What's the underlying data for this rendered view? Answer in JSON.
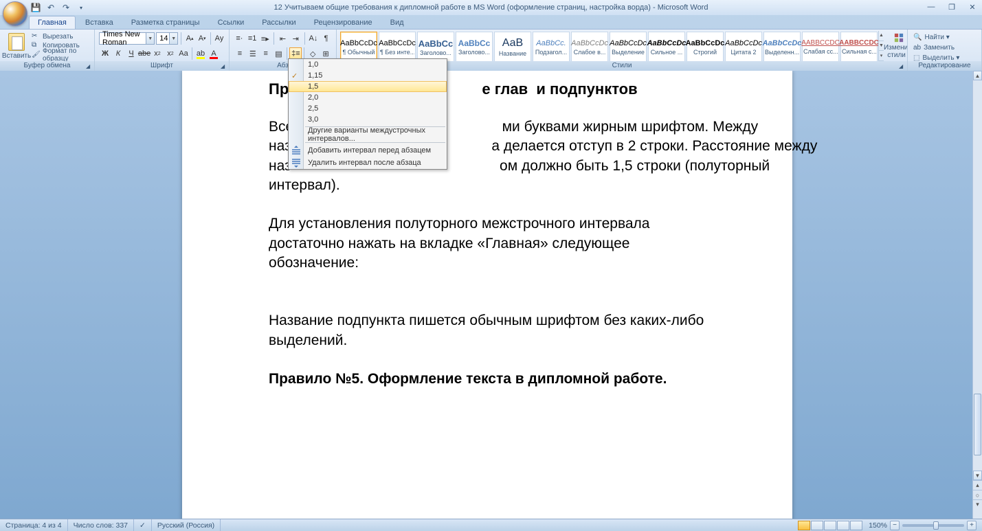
{
  "title": "12 Учитываем общие требования к дипломной работе в MS Word (оформление страниц, настройка ворда) - Microsoft Word",
  "tabs": [
    "Главная",
    "Вставка",
    "Разметка страницы",
    "Ссылки",
    "Рассылки",
    "Рецензирование",
    "Вид"
  ],
  "active_tab": 0,
  "clipboard": {
    "paste": "Вставить",
    "cut": "Вырезать",
    "copy": "Копировать",
    "format": "Формат по образцу",
    "label": "Буфер обмена"
  },
  "font": {
    "name": "Times New Roman",
    "size": "14",
    "label": "Шрифт"
  },
  "para": {
    "label": "Абз"
  },
  "styles": {
    "label": "Стили",
    "items": [
      {
        "preview": "AaBbCcDc",
        "name": "¶ Обычный",
        "sel": true,
        "style": "font-size:11px;color:#000"
      },
      {
        "preview": "AaBbCcDc",
        "name": "¶ Без инте...",
        "style": "font-size:11px;color:#000"
      },
      {
        "preview": "AaBbCc",
        "name": "Заголово...",
        "style": "font-size:13px;color:#365f91;font-weight:bold"
      },
      {
        "preview": "AaBbCc",
        "name": "Заголово...",
        "style": "font-size:12px;color:#4f81bd;font-weight:bold"
      },
      {
        "preview": "АаВ",
        "name": "Название",
        "style": "font-size:16px;color:#17365d"
      },
      {
        "preview": "AaBbCc.",
        "name": "Подзагол...",
        "style": "font-size:11px;color:#4f81bd;font-style:italic"
      },
      {
        "preview": "AaBbCcDc",
        "name": "Слабое в...",
        "style": "font-size:11px;color:#808080;font-style:italic"
      },
      {
        "preview": "AaBbCcDc",
        "name": "Выделение",
        "style": "font-size:11px;color:#000;font-style:italic"
      },
      {
        "preview": "AaBbCcDc",
        "name": "Сильное ...",
        "style": "font-size:11px;color:#000;font-style:italic;font-weight:bold"
      },
      {
        "preview": "AaBbCcDc",
        "name": "Строгий",
        "style": "font-size:11px;color:#000;font-weight:bold"
      },
      {
        "preview": "AaBbCcDc",
        "name": "Цитата 2",
        "style": "font-size:11px;color:#000;font-style:italic"
      },
      {
        "preview": "AaBbCcDc",
        "name": "Выделенн...",
        "style": "font-size:11px;color:#4f81bd;font-style:italic;font-weight:bold"
      },
      {
        "preview": "AABBCCDC",
        "name": "Слабая сс...",
        "style": "font-size:10px;color:#c0504d;text-decoration:underline"
      },
      {
        "preview": "AABBCCDC",
        "name": "Сильная с...",
        "style": "font-size:10px;color:#c0504d;font-weight:bold;text-decoration:underline"
      }
    ],
    "change": "Изменить стили ▾"
  },
  "editing": {
    "find": "Найти ▾",
    "replace": "Заменить",
    "select": "Выделить ▾",
    "label": "Редактирование"
  },
  "line_spacing": {
    "options": [
      "1,0",
      "1,15",
      "1,5",
      "2,0",
      "2,5",
      "3,0"
    ],
    "checked": 1,
    "hover": 2,
    "more": "Другие варианты междустрочных интервалов...",
    "add_before": "Добавить интервал перед абзацем",
    "remove_after": "Удалить интервал после абзаца"
  },
  "doc": {
    "h1_partial": "Пр                                              е глав  и подпунктов",
    "p1a": "Все                                                    ми буквами жирным шрифтом. Между",
    "p1b": "наз                                                  а делается отступ в 2 строки. Расстояние между",
    "p1c": "наз                                                    ом должно быть 1,5 строки (полуторный",
    "p1d": "интервал).",
    "p2": "Для установления полуторного межстрочного интервала достаточно нажать на вкладке «Главная» следующее обозначение:",
    "p3": "Название подпункта пишется обычным шрифтом без каких-либо выделений.",
    "h2": "Правило №5. Оформление текста в дипломной работе."
  },
  "status": {
    "page": "Страница: 4 из 4",
    "words": "Число слов: 337",
    "lang": "Русский (Россия)",
    "zoom": "150%"
  }
}
